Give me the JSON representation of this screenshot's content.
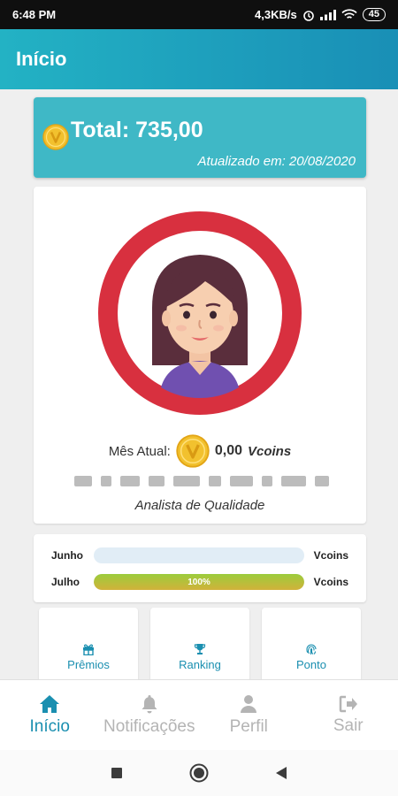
{
  "status_bar": {
    "time": "6:48 PM",
    "net_speed": "4,3KB/s",
    "battery": "45"
  },
  "app_bar": {
    "title": "Início"
  },
  "total_card": {
    "label": "Total: 735,00",
    "updated": "Atualizado em: 20/08/2020"
  },
  "profile": {
    "month_label": "Mês Atual:",
    "month_value": "0,00",
    "month_unit": "Vcoins",
    "role": "Analista de Qualidade"
  },
  "progress": [
    {
      "month": "Junho",
      "percent": 0,
      "percent_label": "",
      "unit": "Vcoins"
    },
    {
      "month": "Julho",
      "percent": 100,
      "percent_label": "100%",
      "unit": "Vcoins"
    }
  ],
  "tiles": [
    {
      "label": "Prêmios",
      "icon": "gift-icon"
    },
    {
      "label": "Ranking",
      "icon": "trophy-icon"
    },
    {
      "label": "Ponto",
      "icon": "fingerprint-icon"
    }
  ],
  "bottom_nav": [
    {
      "label": "Início",
      "icon": "home-icon",
      "active": true
    },
    {
      "label": "Notificações",
      "icon": "bell-icon",
      "active": false
    },
    {
      "label": "Perfil",
      "icon": "user-icon",
      "active": false
    },
    {
      "label": "Sair",
      "icon": "logout-icon",
      "active": false
    }
  ],
  "colors": {
    "primary": "#1a8fb0",
    "app_bar_start": "#23b2c4",
    "total_card": "#3fb8c6",
    "avatar_ring": "#d8303f",
    "coin": "#f2c12e"
  }
}
